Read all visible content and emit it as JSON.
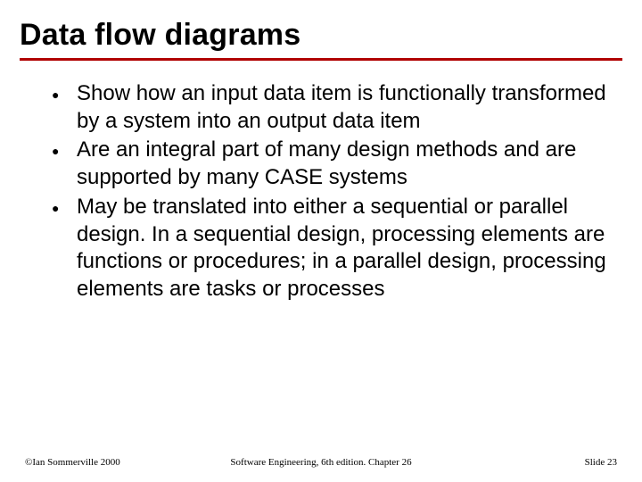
{
  "title": "Data flow diagrams",
  "bullets": [
    "Show how an input data item is functionally transformed by a system into an output data item",
    "Are an integral part of many design methods and are supported by many CASE systems",
    "May be translated into either a sequential or parallel design. In a sequential design, processing elements are functions or procedures; in a parallel design, processing elements are tasks or processes"
  ],
  "footer": {
    "left": "©Ian Sommerville 2000",
    "center": "Software Engineering, 6th edition. Chapter 26",
    "right": "Slide 23"
  }
}
